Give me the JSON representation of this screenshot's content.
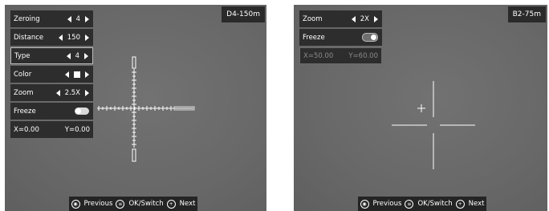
{
  "left_screen": {
    "tag": "D4-150m",
    "menu": [
      {
        "label": "Zeroing",
        "value": "4"
      },
      {
        "label": "Distance",
        "value": "150"
      },
      {
        "label": "Type",
        "value": "4"
      },
      {
        "label": "Color",
        "value": "white-swatch"
      },
      {
        "label": "Zoom",
        "value": "2.5X"
      },
      {
        "label": "Freeze",
        "value": "off"
      }
    ],
    "coords": {
      "x": "X=0.00",
      "y": "Y=0.00"
    },
    "footer": {
      "previous": "Previous",
      "ok": "OK/Switch",
      "next": "Next"
    }
  },
  "right_screen": {
    "tag": "B2-75m",
    "menu": [
      {
        "label": "Zoom",
        "value": "2X"
      },
      {
        "label": "Freeze",
        "value": "on"
      }
    ],
    "coords": {
      "x": "X=50.00",
      "y": "Y=60.00"
    },
    "footer": {
      "previous": "Previous",
      "ok": "OK/Switch",
      "next": "Next"
    }
  },
  "icons": {
    "previous": "dial-icon",
    "ok": "menu-icon",
    "next": "plus-icon"
  }
}
